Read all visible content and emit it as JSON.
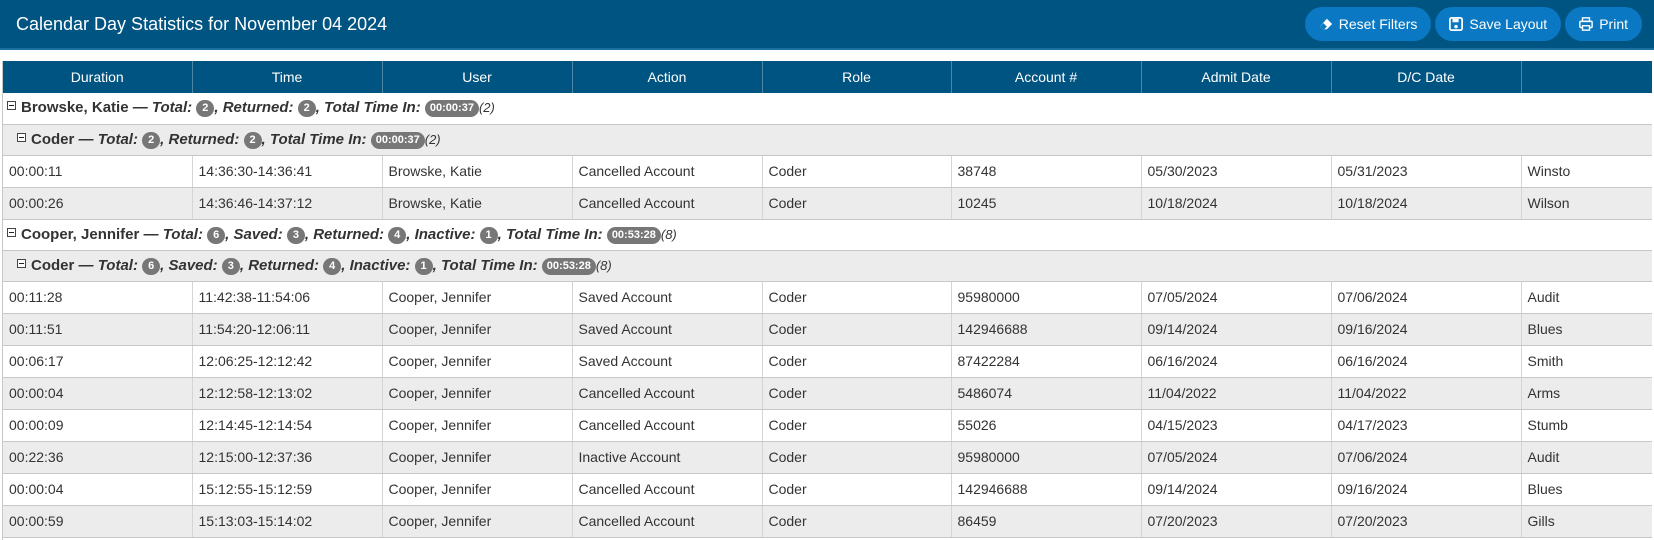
{
  "header": {
    "title": "Calendar Day Statistics for November 04 2024",
    "buttons": {
      "reset": "Reset Filters",
      "save": "Save Layout",
      "print": "Print"
    }
  },
  "columns": [
    "Duration",
    "Time",
    "User",
    "Action",
    "Role",
    "Account #",
    "Admit Date",
    "D/C Date",
    ""
  ],
  "labels": {
    "dash": " — ",
    "total": "Total:",
    "saved": "Saved:",
    "returned": "Returned:",
    "inactive": "Inactive:",
    "total_time": "Total Time In:"
  },
  "groups": [
    {
      "user": "Browske, Katie",
      "total": "2",
      "returned": "2",
      "time": "00:00:37",
      "count": "(2)",
      "sub": {
        "role": "Coder",
        "total": "2",
        "returned": "2",
        "time": "00:00:37",
        "count": "(2)"
      },
      "rows": [
        [
          "00:00:11",
          "14:36:30-14:36:41",
          "Browske, Katie",
          "Cancelled Account",
          "Coder",
          "38748",
          "05/30/2023",
          "05/31/2023",
          "Winsto"
        ],
        [
          "00:00:26",
          "14:36:46-14:37:12",
          "Browske, Katie",
          "Cancelled Account",
          "Coder",
          "10245",
          "10/18/2024",
          "10/18/2024",
          "Wilson"
        ]
      ]
    },
    {
      "user": "Cooper, Jennifer",
      "total": "6",
      "saved": "3",
      "returned": "4",
      "inactive": "1",
      "time": "00:53:28",
      "count": "(8)",
      "sub": {
        "role": "Coder",
        "total": "6",
        "saved": "3",
        "returned": "4",
        "inactive": "1",
        "time": "00:53:28",
        "count": "(8)"
      },
      "rows": [
        [
          "00:11:28",
          "11:42:38-11:54:06",
          "Cooper, Jennifer",
          "Saved Account",
          "Coder",
          "95980000",
          "07/05/2024",
          "07/06/2024",
          "Audit"
        ],
        [
          "00:11:51",
          "11:54:20-12:06:11",
          "Cooper, Jennifer",
          "Saved Account",
          "Coder",
          "142946688",
          "09/14/2024",
          "09/16/2024",
          "Blues"
        ],
        [
          "00:06:17",
          "12:06:25-12:12:42",
          "Cooper, Jennifer",
          "Saved Account",
          "Coder",
          "87422284",
          "06/16/2024",
          "06/16/2024",
          "Smith"
        ],
        [
          "00:00:04",
          "12:12:58-12:13:02",
          "Cooper, Jennifer",
          "Cancelled Account",
          "Coder",
          "5486074",
          "11/04/2022",
          "11/04/2022",
          "Arms"
        ],
        [
          "00:00:09",
          "12:14:45-12:14:54",
          "Cooper, Jennifer",
          "Cancelled Account",
          "Coder",
          "55026",
          "04/15/2023",
          "04/17/2023",
          "Stumb"
        ],
        [
          "00:22:36",
          "12:15:00-12:37:36",
          "Cooper, Jennifer",
          "Inactive Account",
          "Coder",
          "95980000",
          "07/05/2024",
          "07/06/2024",
          "Audit"
        ],
        [
          "00:00:04",
          "15:12:55-15:12:59",
          "Cooper, Jennifer",
          "Cancelled Account",
          "Coder",
          "142946688",
          "09/14/2024",
          "09/16/2024",
          "Blues"
        ],
        [
          "00:00:59",
          "15:13:03-15:14:02",
          "Cooper, Jennifer",
          "Cancelled Account",
          "Coder",
          "86459",
          "07/20/2023",
          "07/20/2023",
          "Gills"
        ]
      ]
    }
  ]
}
